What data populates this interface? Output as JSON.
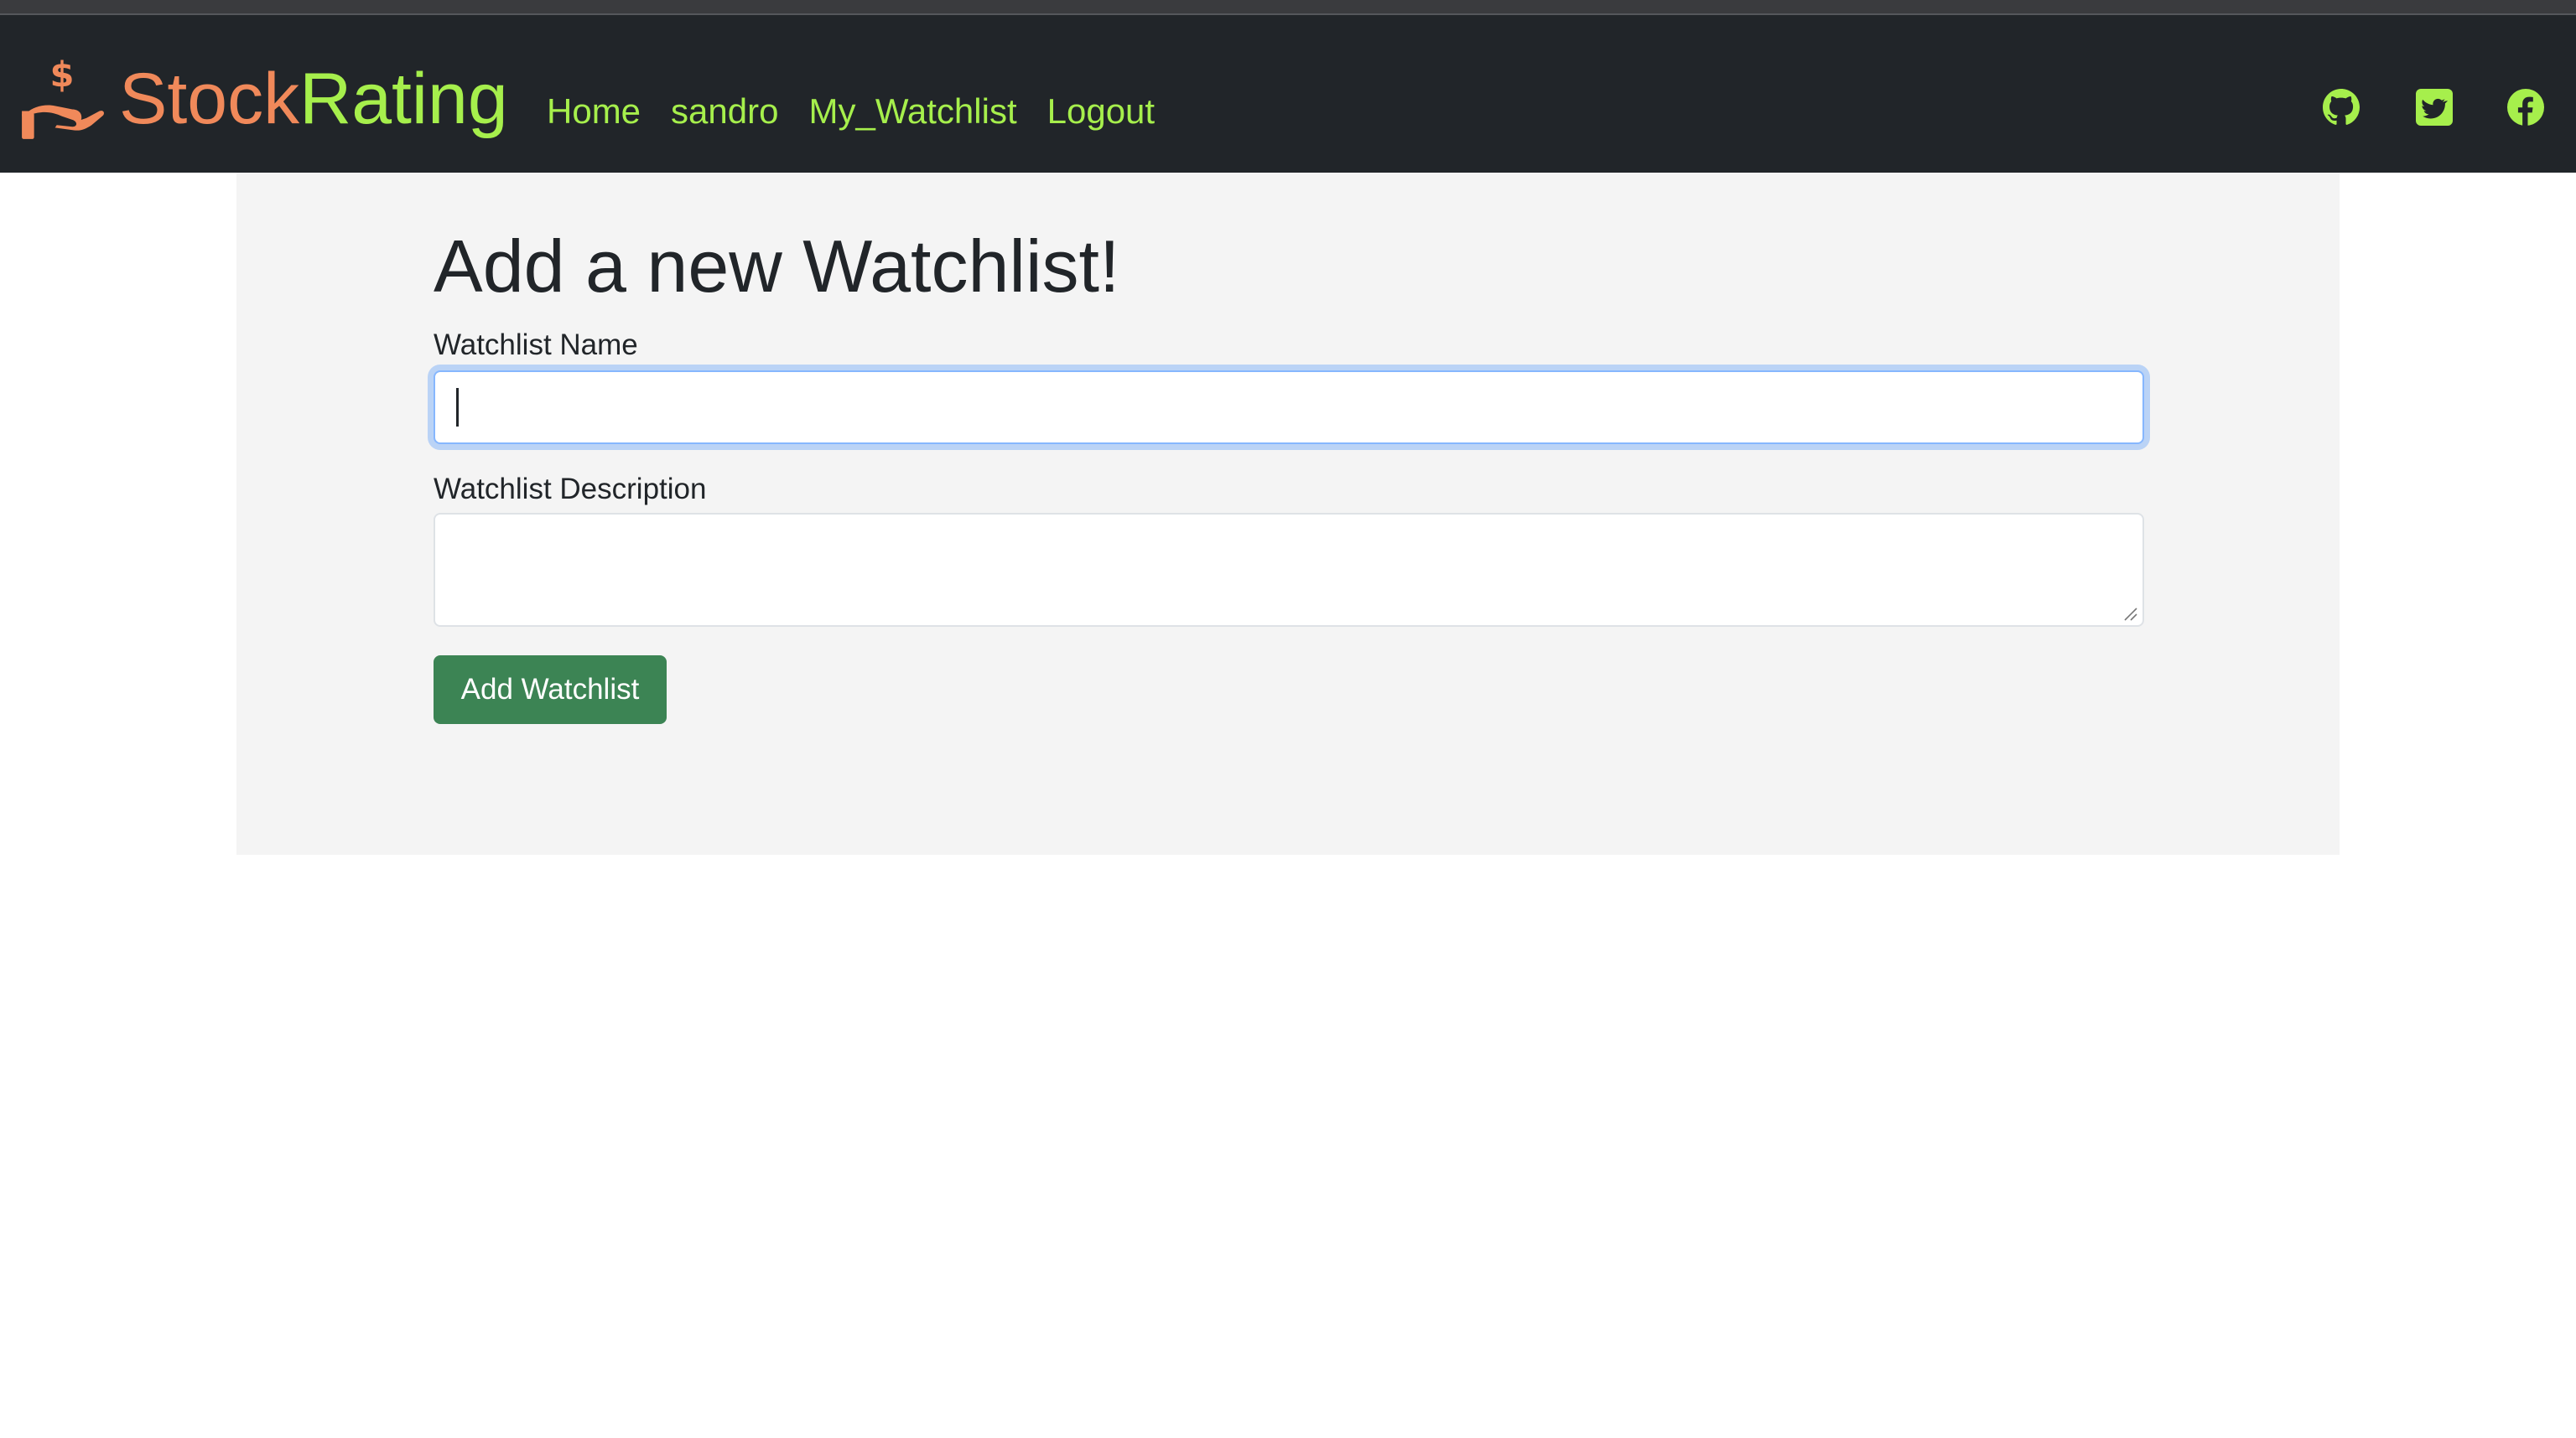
{
  "navbar": {
    "brand": {
      "part1": "Stock",
      "part2": "Rating",
      "icon": "hand-dollar-icon"
    },
    "links": [
      "Home",
      "sandro",
      "My_Watchlist",
      "Logout"
    ],
    "social_icons": [
      "github-icon",
      "twitter-icon",
      "facebook-icon"
    ]
  },
  "form": {
    "title": "Add a new Watchlist!",
    "name_label": "Watchlist Name",
    "name_value": "",
    "description_label": "Watchlist Description",
    "description_value": "",
    "submit_label": "Add Watchlist"
  },
  "colors": {
    "navbar_bg": "#212529",
    "brand_orange": "#f0895a",
    "link_green": "#a6ef4c",
    "button_green": "#3c8454",
    "container_bg": "#f4f4f4"
  }
}
